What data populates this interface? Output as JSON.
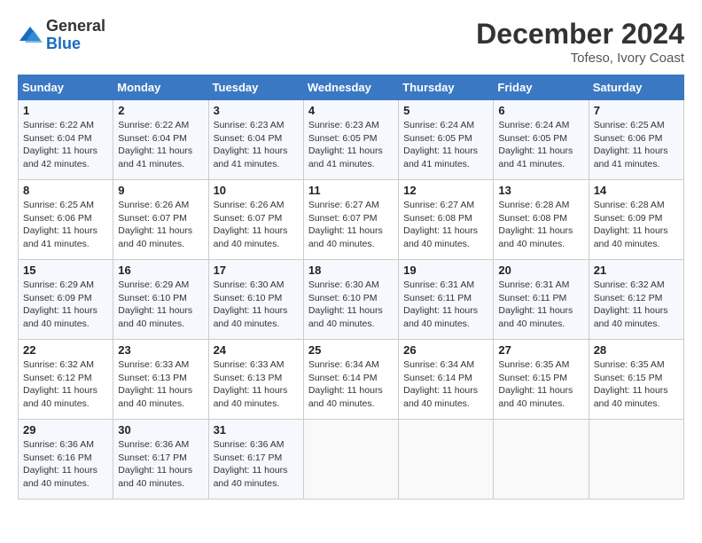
{
  "header": {
    "logo_general": "General",
    "logo_blue": "Blue",
    "month_title": "December 2024",
    "subtitle": "Tofeso, Ivory Coast"
  },
  "weekdays": [
    "Sunday",
    "Monday",
    "Tuesday",
    "Wednesday",
    "Thursday",
    "Friday",
    "Saturday"
  ],
  "weeks": [
    [
      {
        "day": 1,
        "sunrise": "6:22 AM",
        "sunset": "6:04 PM",
        "daylight": "11 hours and 42 minutes."
      },
      {
        "day": 2,
        "sunrise": "6:22 AM",
        "sunset": "6:04 PM",
        "daylight": "11 hours and 41 minutes."
      },
      {
        "day": 3,
        "sunrise": "6:23 AM",
        "sunset": "6:04 PM",
        "daylight": "11 hours and 41 minutes."
      },
      {
        "day": 4,
        "sunrise": "6:23 AM",
        "sunset": "6:05 PM",
        "daylight": "11 hours and 41 minutes."
      },
      {
        "day": 5,
        "sunrise": "6:24 AM",
        "sunset": "6:05 PM",
        "daylight": "11 hours and 41 minutes."
      },
      {
        "day": 6,
        "sunrise": "6:24 AM",
        "sunset": "6:05 PM",
        "daylight": "11 hours and 41 minutes."
      },
      {
        "day": 7,
        "sunrise": "6:25 AM",
        "sunset": "6:06 PM",
        "daylight": "11 hours and 41 minutes."
      }
    ],
    [
      {
        "day": 8,
        "sunrise": "6:25 AM",
        "sunset": "6:06 PM",
        "daylight": "11 hours and 41 minutes."
      },
      {
        "day": 9,
        "sunrise": "6:26 AM",
        "sunset": "6:07 PM",
        "daylight": "11 hours and 40 minutes."
      },
      {
        "day": 10,
        "sunrise": "6:26 AM",
        "sunset": "6:07 PM",
        "daylight": "11 hours and 40 minutes."
      },
      {
        "day": 11,
        "sunrise": "6:27 AM",
        "sunset": "6:07 PM",
        "daylight": "11 hours and 40 minutes."
      },
      {
        "day": 12,
        "sunrise": "6:27 AM",
        "sunset": "6:08 PM",
        "daylight": "11 hours and 40 minutes."
      },
      {
        "day": 13,
        "sunrise": "6:28 AM",
        "sunset": "6:08 PM",
        "daylight": "11 hours and 40 minutes."
      },
      {
        "day": 14,
        "sunrise": "6:28 AM",
        "sunset": "6:09 PM",
        "daylight": "11 hours and 40 minutes."
      }
    ],
    [
      {
        "day": 15,
        "sunrise": "6:29 AM",
        "sunset": "6:09 PM",
        "daylight": "11 hours and 40 minutes."
      },
      {
        "day": 16,
        "sunrise": "6:29 AM",
        "sunset": "6:10 PM",
        "daylight": "11 hours and 40 minutes."
      },
      {
        "day": 17,
        "sunrise": "6:30 AM",
        "sunset": "6:10 PM",
        "daylight": "11 hours and 40 minutes."
      },
      {
        "day": 18,
        "sunrise": "6:30 AM",
        "sunset": "6:10 PM",
        "daylight": "11 hours and 40 minutes."
      },
      {
        "day": 19,
        "sunrise": "6:31 AM",
        "sunset": "6:11 PM",
        "daylight": "11 hours and 40 minutes."
      },
      {
        "day": 20,
        "sunrise": "6:31 AM",
        "sunset": "6:11 PM",
        "daylight": "11 hours and 40 minutes."
      },
      {
        "day": 21,
        "sunrise": "6:32 AM",
        "sunset": "6:12 PM",
        "daylight": "11 hours and 40 minutes."
      }
    ],
    [
      {
        "day": 22,
        "sunrise": "6:32 AM",
        "sunset": "6:12 PM",
        "daylight": "11 hours and 40 minutes."
      },
      {
        "day": 23,
        "sunrise": "6:33 AM",
        "sunset": "6:13 PM",
        "daylight": "11 hours and 40 minutes."
      },
      {
        "day": 24,
        "sunrise": "6:33 AM",
        "sunset": "6:13 PM",
        "daylight": "11 hours and 40 minutes."
      },
      {
        "day": 25,
        "sunrise": "6:34 AM",
        "sunset": "6:14 PM",
        "daylight": "11 hours and 40 minutes."
      },
      {
        "day": 26,
        "sunrise": "6:34 AM",
        "sunset": "6:14 PM",
        "daylight": "11 hours and 40 minutes."
      },
      {
        "day": 27,
        "sunrise": "6:35 AM",
        "sunset": "6:15 PM",
        "daylight": "11 hours and 40 minutes."
      },
      {
        "day": 28,
        "sunrise": "6:35 AM",
        "sunset": "6:15 PM",
        "daylight": "11 hours and 40 minutes."
      }
    ],
    [
      {
        "day": 29,
        "sunrise": "6:36 AM",
        "sunset": "6:16 PM",
        "daylight": "11 hours and 40 minutes."
      },
      {
        "day": 30,
        "sunrise": "6:36 AM",
        "sunset": "6:17 PM",
        "daylight": "11 hours and 40 minutes."
      },
      {
        "day": 31,
        "sunrise": "6:36 AM",
        "sunset": "6:17 PM",
        "daylight": "11 hours and 40 minutes."
      },
      null,
      null,
      null,
      null
    ]
  ]
}
